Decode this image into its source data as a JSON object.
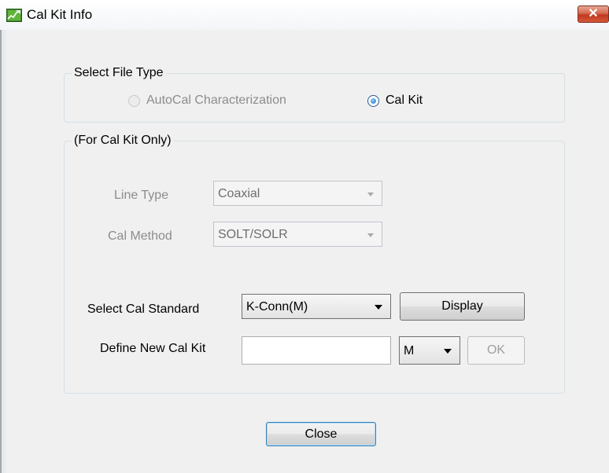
{
  "window": {
    "title": "Cal Kit Info",
    "close_glyph": "✕"
  },
  "file_type": {
    "legend": "Select File Type",
    "options": [
      {
        "label": "AutoCal Characterization",
        "checked": false,
        "enabled": false
      },
      {
        "label": "Cal Kit",
        "checked": true,
        "enabled": true
      }
    ]
  },
  "cal_kit": {
    "legend": "(For Cal Kit Only)",
    "line_type": {
      "label": "Line Type",
      "value": "Coaxial",
      "enabled": false
    },
    "cal_method": {
      "label": "Cal Method",
      "value": "SOLT/SOLR",
      "enabled": false
    },
    "cal_standard": {
      "label": "Select Cal Standard",
      "value": "K-Conn(M)",
      "enabled": true
    },
    "display_button": "Display",
    "new_kit": {
      "label": "Define New Cal Kit",
      "value": "",
      "gender_value": "M"
    },
    "ok_button": "OK"
  },
  "close_button": "Close",
  "colors": {
    "dialog_background": "#f0f0f0",
    "group_border": "#d5dfe5",
    "close_button_red": "#c8482d",
    "disabled_text": "#8c8c8c"
  },
  "icons": {
    "app_icon": "chart-icon",
    "close_icon": "close-icon",
    "dropdown_arrow": "chevron-down-icon"
  }
}
